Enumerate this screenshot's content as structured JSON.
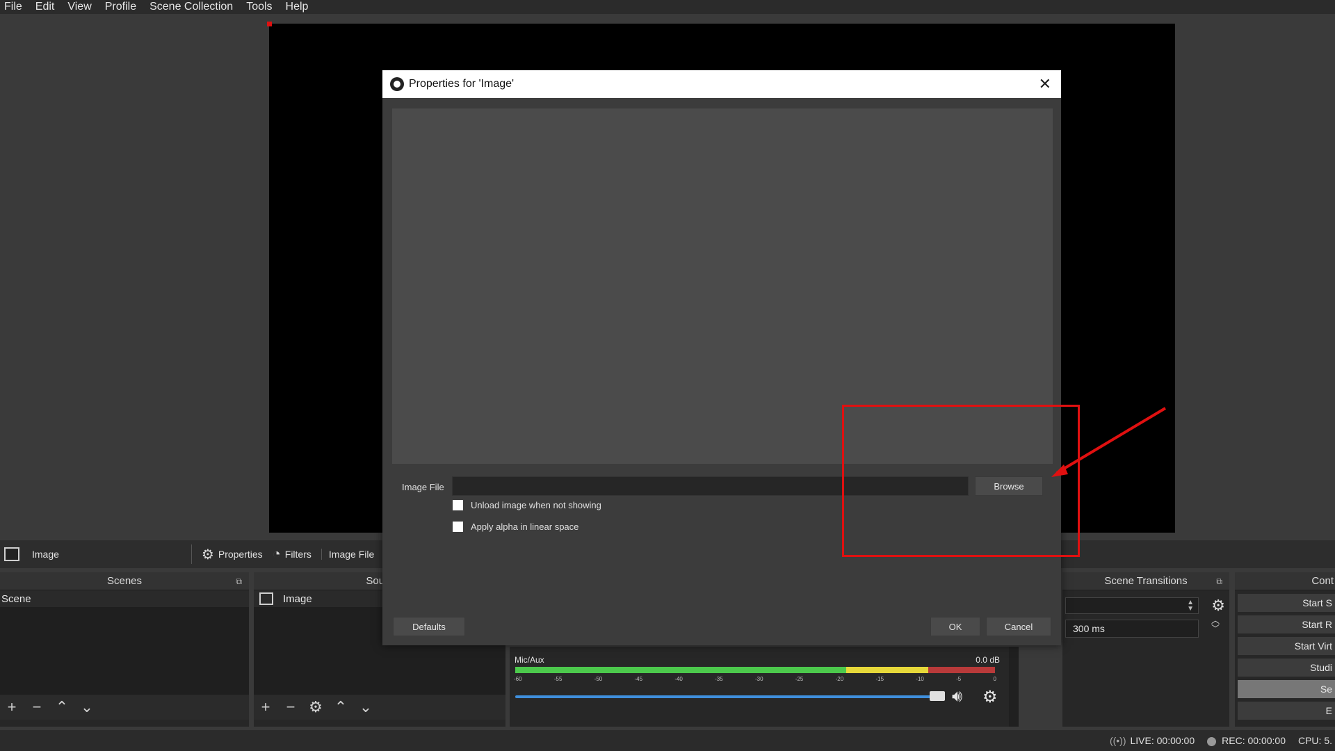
{
  "menu": [
    "File",
    "Edit",
    "View",
    "Profile",
    "Scene Collection",
    "Tools",
    "Help"
  ],
  "source_toolbar": {
    "source_name": "Image",
    "properties_label": "Properties",
    "filters_label": "Filters",
    "image_file_label": "Image File"
  },
  "scenes": {
    "title": "Scenes",
    "items": [
      "Scene"
    ]
  },
  "sources": {
    "title": "Sourc",
    "items": [
      "Image"
    ]
  },
  "transitions": {
    "title": "Scene Transitions",
    "duration": "300 ms"
  },
  "controls": {
    "title": "Cont",
    "buttons": [
      "Start S",
      "Start R",
      "Start Virt",
      "Studi",
      "Se",
      "E"
    ]
  },
  "mixer": {
    "channel": "Mic/Aux",
    "db": "0.0 dB",
    "ticks": [
      "-60",
      "-55",
      "-50",
      "-45",
      "-40",
      "-35",
      "-30",
      "-25",
      "-20",
      "-15",
      "-10",
      "-5",
      "0"
    ],
    "volume_fraction": 1.0
  },
  "status": {
    "live": "LIVE: 00:00:00",
    "rec": "REC: 00:00:00",
    "cpu": "CPU: 5."
  },
  "dialog": {
    "title": "Properties for 'Image'",
    "image_file_label": "Image File",
    "image_file_value": "",
    "browse_label": "Browse",
    "unload_label": "Unload image when not showing",
    "alpha_label": "Apply alpha in linear space",
    "defaults_label": "Defaults",
    "ok_label": "OK",
    "cancel_label": "Cancel"
  },
  "colors": {
    "annotation": "#e01010",
    "meter_green": "#4cc94c",
    "meter_yellow": "#e6d83a",
    "meter_red": "#b83a3a",
    "volume_slider": "#3f8fdc"
  }
}
